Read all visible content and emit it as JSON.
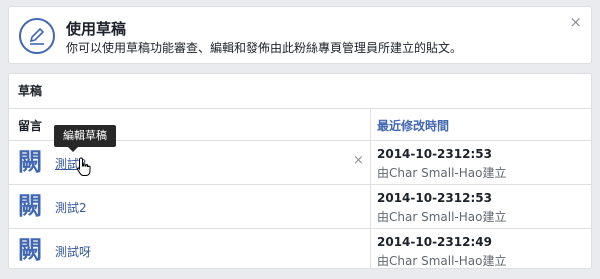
{
  "banner": {
    "title": "使用草稿",
    "description": "你可以使用草稿功能審查、編輯和發佈由此粉絲專頁管理員所建立的貼文。",
    "close_glyph": "×",
    "icon": "pencil-icon"
  },
  "drafts": {
    "header": "草稿",
    "columns": {
      "message": "留言",
      "last_modified": "最近修改時間"
    },
    "rows": [
      {
        "glyph": "闕",
        "text": "測試3",
        "time": "2014-10-2312:53",
        "author": "由Char Small-Hao建立"
      },
      {
        "glyph": "闕",
        "text": "測試2",
        "time": "2014-10-2312:53",
        "author": "由Char Small-Hao建立"
      },
      {
        "glyph": "闕",
        "text": "測試呀",
        "time": "2014-10-2312:49",
        "author": "由Char Small-Hao建立"
      }
    ],
    "delete_glyph": "×"
  },
  "tooltip": {
    "text": "編輯草稿"
  },
  "colors": {
    "accent": "#4267b2",
    "link": "#365899",
    "border": "#dddfe2",
    "background": "#e9ebee"
  }
}
